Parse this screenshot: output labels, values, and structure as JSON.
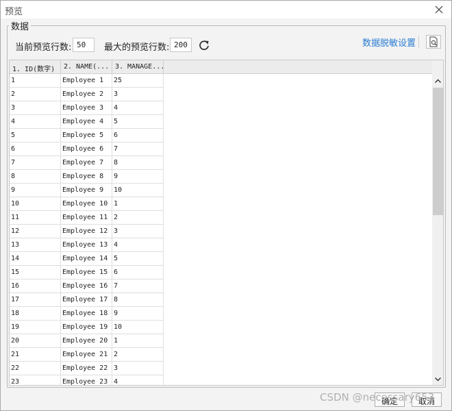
{
  "window": {
    "title": "预览"
  },
  "group": {
    "legend": "数据"
  },
  "controls": {
    "current_rows_label": "当前预览行数:",
    "current_rows_value": "50",
    "max_rows_label": "最大的预览行数:",
    "max_rows_value": "200",
    "mask_settings_link": "数据脱敏设置"
  },
  "table": {
    "columns": [
      "1. ID(数字)",
      "2. NAME(...",
      "3. MANAGE..."
    ],
    "rows": [
      [
        "1",
        "Employee 1",
        "25"
      ],
      [
        "2",
        "Employee 2",
        "3"
      ],
      [
        "3",
        "Employee 3",
        "4"
      ],
      [
        "4",
        "Employee 4",
        "5"
      ],
      [
        "5",
        "Employee 5",
        "6"
      ],
      [
        "6",
        "Employee 6",
        "7"
      ],
      [
        "7",
        "Employee 7",
        "8"
      ],
      [
        "8",
        "Employee 8",
        "9"
      ],
      [
        "9",
        "Employee 9",
        "10"
      ],
      [
        "10",
        "Employee 10",
        "1"
      ],
      [
        "11",
        "Employee 11",
        "2"
      ],
      [
        "12",
        "Employee 12",
        "3"
      ],
      [
        "13",
        "Employee 13",
        "4"
      ],
      [
        "14",
        "Employee 14",
        "5"
      ],
      [
        "15",
        "Employee 15",
        "6"
      ],
      [
        "16",
        "Employee 16",
        "7"
      ],
      [
        "17",
        "Employee 17",
        "8"
      ],
      [
        "18",
        "Employee 18",
        "9"
      ],
      [
        "19",
        "Employee 19",
        "10"
      ],
      [
        "20",
        "Employee 20",
        "1"
      ],
      [
        "21",
        "Employee 21",
        "2"
      ],
      [
        "22",
        "Employee 22",
        "3"
      ],
      [
        "23",
        "Employee 23",
        "4"
      ]
    ]
  },
  "footer": {
    "ok_label": "确定",
    "cancel_label": "取消",
    "watermark": "CSDN @necessary653"
  },
  "colors": {
    "link": "#2b7cd3",
    "header_bg": "#ececec",
    "window_bg": "#f3f3f3"
  },
  "icons": {
    "close": "close-icon",
    "refresh": "refresh-icon",
    "preview": "document-search-icon",
    "scroll_up": "chevron-up-icon",
    "scroll_down": "chevron-down-icon"
  }
}
